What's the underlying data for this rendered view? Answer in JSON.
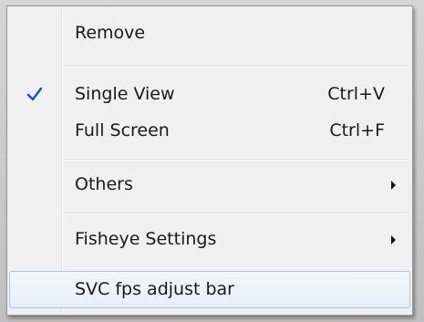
{
  "menu": {
    "items": [
      {
        "label": "Remove",
        "shortcut": ""
      },
      {
        "label": "Single View",
        "shortcut": "Ctrl+V",
        "checked": true
      },
      {
        "label": "Full Screen",
        "shortcut": "Ctrl+F"
      },
      {
        "label": "Others",
        "submenu": true
      },
      {
        "label": "Fisheye Settings",
        "submenu": true
      },
      {
        "label": "SVC fps adjust bar",
        "highlighted": true
      }
    ],
    "check_icon": "checkmark-icon",
    "submenu_icon": "chevron-right-icon",
    "colors": {
      "highlight_border": "#a8c8ea",
      "highlight_fill": "#e5eef8",
      "check": "#1c4fbf",
      "background": "#f0f0f0"
    }
  }
}
